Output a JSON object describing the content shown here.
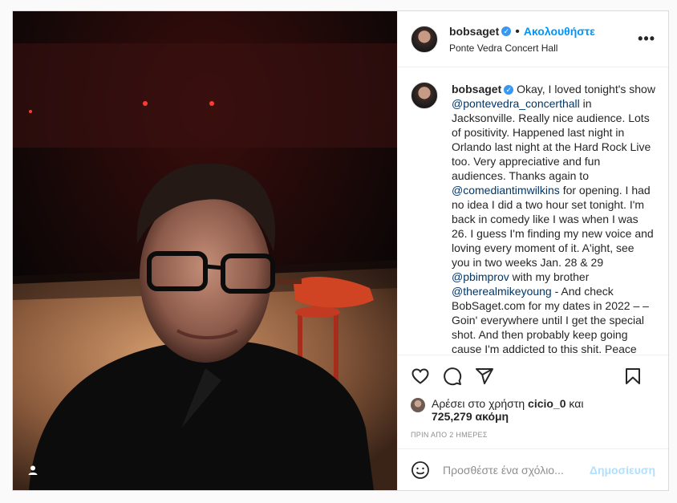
{
  "post": {
    "username": "bobsaget",
    "follow_label": "Ακολουθήστε",
    "location": "Ponte Vedra Concert Hall",
    "more_label": "•••",
    "verified_mark": "✓",
    "caption_parts": {
      "p1": "Okay, I loved tonight's show ",
      "m1": "@pontevedra_concerthall",
      "p2": " in Jacksonville. Really nice audience. Lots of positivity. Happened last night in Orlando last night at the Hard Rock Live too. Very appreciative and fun audiences. Thanks again to ",
      "m2": "@comediantimwilkins",
      "p3": " for opening. I had no idea I did a two hour set tonight. I'm back in comedy like I was when I was 26. I guess I'm finding my new voice and loving every moment of it. A'ight, see you in two weeks Jan. 28 & 29 ",
      "m3": "@pbimprov",
      "p4": " with my brother ",
      "m4": "@therealmikeyoung",
      "p5": " - And check BobSaget.com for my dates in 2022 – – Goin' everywhere until I get the special shot. And then probably keep going cause I'm addicted to this shit. Peace out."
    },
    "likes": {
      "prefix": "Αρέσει στο χρήστη ",
      "user": "cicio_0",
      "mid": " και",
      "count": "725,279 ακόμη"
    },
    "time": "ΠΡΙΝ ΑΠΟ 2 ΗΜΕΡΕΣ",
    "comment_placeholder": "Προσθέστε ένα σχόλιο...",
    "post_label": "Δημοσίευση"
  },
  "icons": {
    "like": "heart-icon",
    "comment": "comment-icon",
    "share": "share-icon",
    "save": "bookmark-icon",
    "emoji": "emoji-icon",
    "tagged": "user-tag-icon"
  },
  "colors": {
    "link": "#0095f6",
    "mention": "#00376b",
    "verified": "#3897f0",
    "muted": "#8e8e8e"
  }
}
